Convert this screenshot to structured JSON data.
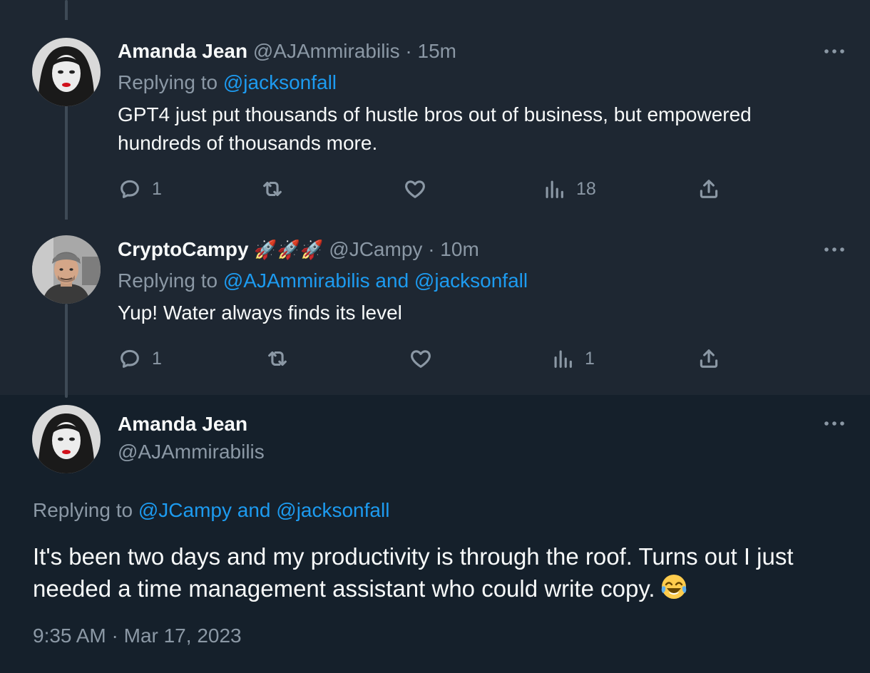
{
  "tweets": [
    {
      "name": "Amanda Jean",
      "handle": "@AJAmmirabilis",
      "time": "15m",
      "replying_prefix": "Replying to",
      "replying_targets": "@jacksonfall",
      "text": "GPT4 just put thousands of hustle bros out of business, but empowered hundreds of thousands more.",
      "stats": {
        "replies": "1",
        "retweets": "",
        "likes": "",
        "views": "18"
      }
    },
    {
      "name": "CryptoCampy",
      "name_emoji": "🚀🚀🚀",
      "handle": "@JCampy",
      "time": "10m",
      "replying_prefix": "Replying to",
      "replying_targets": "@AJAmmirabilis and @jacksonfall",
      "text": "Yup! Water always finds its level",
      "stats": {
        "replies": "1",
        "retweets": "",
        "likes": "",
        "views": "1"
      }
    }
  ],
  "main_tweet": {
    "name": "Amanda Jean",
    "handle": "@AJAmmirabilis",
    "replying_prefix": "Replying to",
    "replying_targets": "@JCampy and @jacksonfall",
    "text": "It's been two days and my productivity is through the roof. Turns out I just needed a time management assistant who could write copy.",
    "emoji": "face-with-tears-of-joy",
    "timestamp": "9:35 AM · Mar 17, 2023"
  },
  "separator": "·",
  "colors": {
    "background": "#15202b",
    "reply_background": "#1e2732",
    "accent": "#1d9bf0",
    "muted": "#8b98a5",
    "text": "#f7f9f9"
  }
}
